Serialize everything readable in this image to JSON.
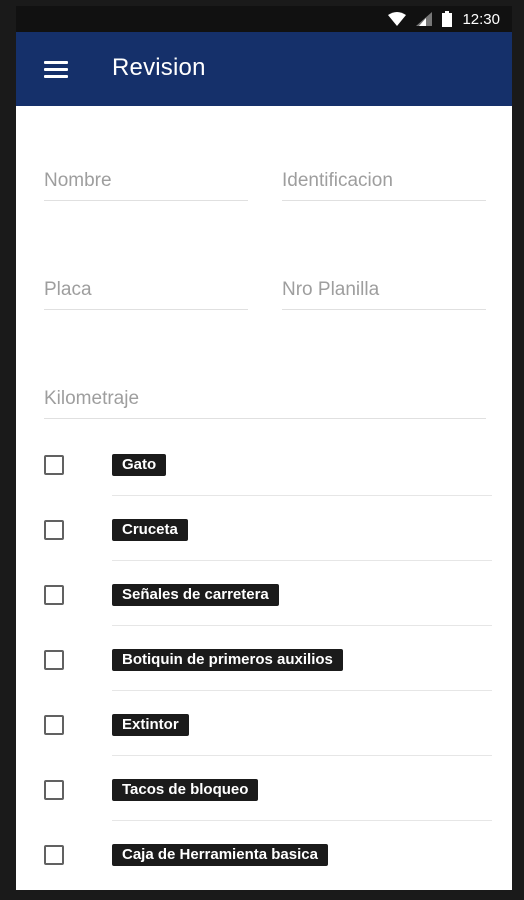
{
  "status_bar": {
    "time": "12:30",
    "icons": [
      "wifi-icon",
      "signal-icon",
      "battery-icon"
    ]
  },
  "app_bar": {
    "menu_icon": "hamburger-menu-icon",
    "title": "Revision",
    "color": "#15306a"
  },
  "form": {
    "nombre": {
      "placeholder": "Nombre",
      "value": ""
    },
    "identificacion": {
      "placeholder": "Identificacion",
      "value": ""
    },
    "placa": {
      "placeholder": "Placa",
      "value": ""
    },
    "nro_planilla": {
      "placeholder": "Nro Planilla",
      "value": ""
    },
    "kilometraje": {
      "placeholder": "Kilometraje",
      "value": ""
    }
  },
  "checklist": [
    {
      "label": "Gato",
      "checked": false
    },
    {
      "label": "Cruceta",
      "checked": false
    },
    {
      "label": "Señales de carretera",
      "checked": false
    },
    {
      "label": "Botiquin de primeros auxilios",
      "checked": false
    },
    {
      "label": "Extintor",
      "checked": false
    },
    {
      "label": "Tacos de bloqueo",
      "checked": false
    },
    {
      "label": "Caja de Herramienta basica",
      "checked": false
    }
  ]
}
